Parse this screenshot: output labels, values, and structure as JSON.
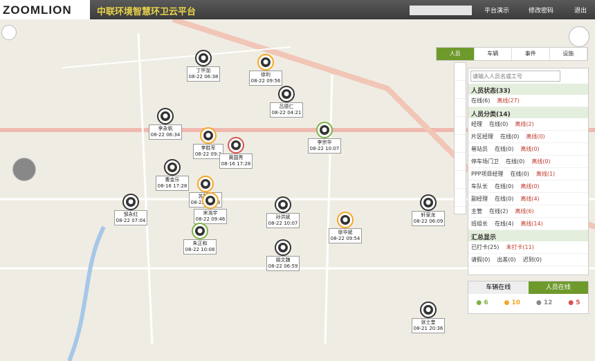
{
  "header": {
    "logo": "ZOOMLION",
    "title": "中联环境智慧环卫云平台",
    "user": "",
    "nav": [
      "平台演示",
      "修改密码",
      "退出"
    ]
  },
  "map_tabs": [
    "人员",
    "车辆",
    "事件",
    "设施"
  ],
  "search": {
    "placeholder": "请输入人员名或工号"
  },
  "status": {
    "title": "人员状态(33)",
    "online": "在线(6)",
    "offline": "离线(27)"
  },
  "categories": {
    "title": "人员分类(14)",
    "items": [
      {
        "name": "经理",
        "online": "在线(0)",
        "offline": "离线(2)"
      },
      {
        "name": "片区经理",
        "online": "在线(0)",
        "offline": "离线(0)"
      },
      {
        "name": "巷站员",
        "online": "在线(0)",
        "offline": "离线(0)"
      },
      {
        "name": "停车场门卫",
        "online": "在线(0)",
        "offline": "离线(0)"
      },
      {
        "name": "PPP项目经理",
        "online": "在线(0)",
        "offline": "离线(1)"
      },
      {
        "name": "车队长",
        "online": "在线(0)",
        "offline": "离线(0)"
      },
      {
        "name": "副经理",
        "online": "在线(0)",
        "offline": "离线(4)"
      },
      {
        "name": "主管",
        "online": "在线(2)",
        "offline": "离线(6)"
      },
      {
        "name": "班组长",
        "online": "在线(4)",
        "offline": "离线(14)"
      }
    ]
  },
  "summary": {
    "title": "汇总显示",
    "row1": [
      "已打卡(25)",
      "未打卡(11)"
    ],
    "row2": [
      "请假(0)",
      "出差(0)",
      "迟到(0)"
    ]
  },
  "legend": {
    "tabs": [
      "车辆在线",
      "人员在线"
    ],
    "counts": [
      "6",
      "10",
      "12",
      "5"
    ],
    "colors": [
      "#7cb342",
      "#f5a623",
      "#888888",
      "#d9534f"
    ]
  },
  "markers": [
    {
      "name": "丁怀加",
      "time": "08-22 06:38",
      "color": "#333333"
    },
    {
      "name": "徐利",
      "time": "08-22 09:56",
      "color": "#f5a623"
    },
    {
      "name": "吕德仁",
      "time": "08-22 04:21",
      "color": "#333333"
    },
    {
      "name": "李永帆",
      "time": "08-22 06:34",
      "color": "#333333"
    },
    {
      "name": "李胜军",
      "time": "08-22 09:3",
      "color": "#f5a623"
    },
    {
      "name": "李宗华",
      "time": "08-22 10:07",
      "color": "#7cb342"
    },
    {
      "name": "黄国秀",
      "time": "08-16 17:28",
      "color": "#d9534f"
    },
    {
      "name": "曹金乐",
      "time": "08-16 17:28",
      "color": "#333333"
    },
    {
      "name": "苏腾龙",
      "time": "08-22 09:28",
      "color": "#f5a623"
    },
    {
      "name": "宋浩宇",
      "time": "08-22 09:46",
      "color": "#f5a623"
    },
    {
      "name": "邹永红",
      "time": "08-22 07:04",
      "color": "#333333"
    },
    {
      "name": "朱正和",
      "time": "08-22 10:08",
      "color": "#7cb342"
    },
    {
      "name": "孙洪斌",
      "time": "08-22 10:07",
      "color": "#333333"
    },
    {
      "name": "徐华斌",
      "time": "08-22 09:54",
      "color": "#f5a623"
    },
    {
      "name": "胡文魏",
      "time": "08-22 06:59",
      "color": "#333333"
    },
    {
      "name": "轩家龙",
      "time": "08-22 06:09",
      "color": "#333333"
    },
    {
      "name": "张士奎",
      "time": "08-21 20:36",
      "color": "#333333"
    }
  ]
}
